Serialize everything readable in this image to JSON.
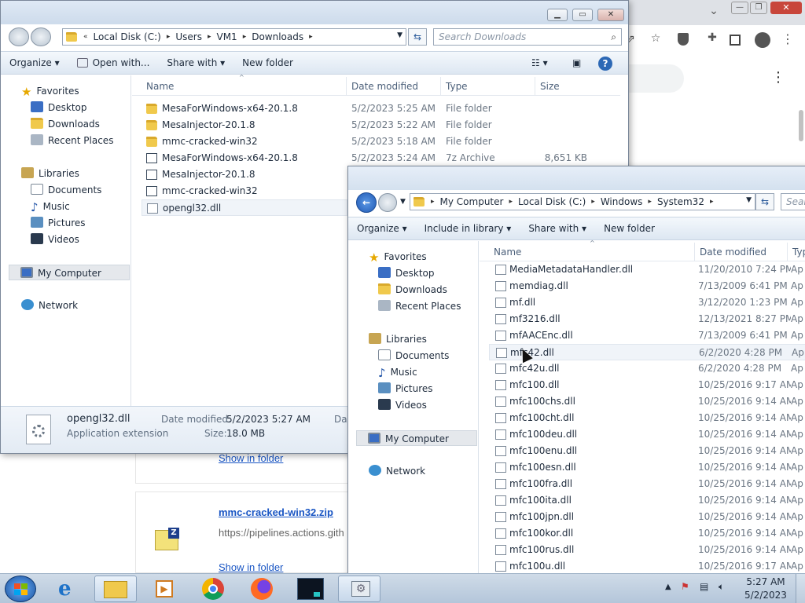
{
  "explorer1": {
    "address": [
      "Local Disk (C:)",
      "Users",
      "VM1",
      "Downloads"
    ],
    "search_placeholder": "Search Downloads",
    "toolbar": {
      "organize": "Organize",
      "open_with": "Open with...",
      "share_with": "Share with",
      "new_folder": "New folder"
    },
    "nav": {
      "favorites": "Favorites",
      "desktop": "Desktop",
      "downloads": "Downloads",
      "recent": "Recent Places",
      "libraries": "Libraries",
      "documents": "Documents",
      "music": "Music",
      "pictures": "Pictures",
      "videos": "Videos",
      "computer": "My Computer",
      "network": "Network"
    },
    "columns": [
      "Name",
      "Date modified",
      "Type",
      "Size"
    ],
    "rows": [
      {
        "name": "MesaForWindows-x64-20.1.8",
        "date": "5/2/2023 5:25 AM",
        "type": "File folder",
        "size": "",
        "icon": "folder-icon"
      },
      {
        "name": "MesaInjector-20.1.8",
        "date": "5/2/2023 5:22 AM",
        "type": "File folder",
        "size": "",
        "icon": "folder-icon"
      },
      {
        "name": "mmc-cracked-win32",
        "date": "5/2/2023 5:18 AM",
        "type": "File folder",
        "size": "",
        "icon": "folder-icon"
      },
      {
        "name": "MesaForWindows-x64-20.1.8",
        "date": "5/2/2023 5:24 AM",
        "type": "7z Archive",
        "size": "8,651 KB",
        "icon": "archive-icon"
      },
      {
        "name": "MesaInjector-20.1.8",
        "date": "",
        "type": "",
        "size": "",
        "icon": "archive-icon"
      },
      {
        "name": "mmc-cracked-win32",
        "date": "",
        "type": "",
        "size": "",
        "icon": "archive-icon"
      },
      {
        "name": "opengl32.dll",
        "date": "",
        "type": "",
        "size": "",
        "icon": "dll-icon"
      }
    ],
    "details": {
      "filename": "opengl32.dll",
      "filetype": "Application extension",
      "modified_label": "Date modified:",
      "modified": "5/2/2023 5:27 AM",
      "size_label": "Size:",
      "size": "18.0 MB",
      "cut_label": "Da"
    }
  },
  "explorer2": {
    "address": [
      "My Computer",
      "Local Disk (C:)",
      "Windows",
      "System32"
    ],
    "search_placeholder": "Sear",
    "toolbar": {
      "organize": "Organize",
      "include": "Include in library",
      "share_with": "Share with",
      "new_folder": "New folder"
    },
    "nav": {
      "favorites": "Favorites",
      "desktop": "Desktop",
      "downloads": "Downloads",
      "recent": "Recent Places",
      "libraries": "Libraries",
      "documents": "Documents",
      "music": "Music",
      "pictures": "Pictures",
      "videos": "Videos",
      "computer": "My Computer",
      "network": "Network"
    },
    "columns": [
      "Name",
      "Date modified",
      "Typ"
    ],
    "rows": [
      {
        "name": "MediaMetadataHandler.dll",
        "date": "11/20/2010 7:24 PM",
        "type": "Ap"
      },
      {
        "name": "memdiag.dll",
        "date": "7/13/2009 6:41 PM",
        "type": "Ap"
      },
      {
        "name": "mf.dll",
        "date": "3/12/2020 1:23 PM",
        "type": "Ap"
      },
      {
        "name": "mf3216.dll",
        "date": "12/13/2021 8:27 PM",
        "type": "Ap"
      },
      {
        "name": "mfAACEnc.dll",
        "date": "7/13/2009 6:41 PM",
        "type": "Ap"
      },
      {
        "name": "mfc42.dll",
        "date": "6/2/2020 4:28 PM",
        "type": "Ap"
      },
      {
        "name": "mfc42u.dll",
        "date": "6/2/2020 4:28 PM",
        "type": "Ap"
      },
      {
        "name": "mfc100.dll",
        "date": "10/25/2016 9:17 AM",
        "type": "Ap"
      },
      {
        "name": "mfc100chs.dll",
        "date": "10/25/2016 9:14 AM",
        "type": "Ap"
      },
      {
        "name": "mfc100cht.dll",
        "date": "10/25/2016 9:14 AM",
        "type": "Ap"
      },
      {
        "name": "mfc100deu.dll",
        "date": "10/25/2016 9:14 AM",
        "type": "Ap"
      },
      {
        "name": "mfc100enu.dll",
        "date": "10/25/2016 9:14 AM",
        "type": "Ap"
      },
      {
        "name": "mfc100esn.dll",
        "date": "10/25/2016 9:14 AM",
        "type": "Ap"
      },
      {
        "name": "mfc100fra.dll",
        "date": "10/25/2016 9:14 AM",
        "type": "Ap"
      },
      {
        "name": "mfc100ita.dll",
        "date": "10/25/2016 9:14 AM",
        "type": "Ap"
      },
      {
        "name": "mfc100jpn.dll",
        "date": "10/25/2016 9:14 AM",
        "type": "Ap"
      },
      {
        "name": "mfc100kor.dll",
        "date": "10/25/2016 9:14 AM",
        "type": "Ap"
      },
      {
        "name": "mfc100rus.dll",
        "date": "10/25/2016 9:14 AM",
        "type": "Ap"
      },
      {
        "name": "mfc100u.dll",
        "date": "10/25/2016 9:17 AM",
        "type": "Ap"
      }
    ]
  },
  "chrome_downloads": {
    "show_in_folder": "Show in folder",
    "item_name": "mmc-cracked-win32.zip",
    "item_url": "https://pipelines.actions.gith",
    "show_in_folder_2": "Show in folder"
  },
  "taskbar": {
    "time": "5:27 AM",
    "date": "5/2/2023",
    "apps": [
      "start-button",
      "ie-icon",
      "explorer-icon",
      "media-icon",
      "chrome-icon",
      "firefox-icon",
      "terminal-icon",
      "settings-icon"
    ]
  },
  "colors": {
    "accent": "#1a56c4",
    "title_bar": "#dfe9f5",
    "taskbar": "#b4c6da"
  }
}
